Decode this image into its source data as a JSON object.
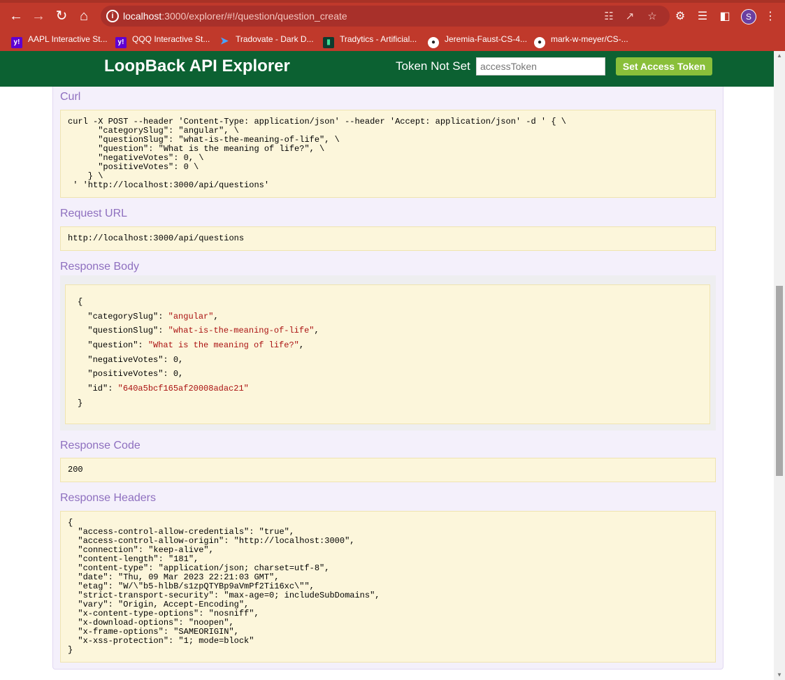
{
  "browser": {
    "url_host": "localhost",
    "url_rest": ":3000/explorer/#!/question/question_create",
    "profile_initial": "S",
    "bookmarks": [
      {
        "label": "AAPL Interactive St...",
        "icon": "yahoo-icon"
      },
      {
        "label": "QQQ Interactive St...",
        "icon": "yahoo-icon"
      },
      {
        "label": "Tradovate - Dark D...",
        "icon": "tradovate-icon"
      },
      {
        "label": "Tradytics - Artificial...",
        "icon": "tradytics-icon"
      },
      {
        "label": "Jeremia-Faust-CS-4...",
        "icon": "github-icon"
      },
      {
        "label": "mark-w-meyer/CS-...",
        "icon": "github-icon"
      }
    ]
  },
  "header": {
    "title": "LoopBack API Explorer",
    "token_status": "Token Not Set",
    "token_placeholder": "accessToken",
    "token_button": "Set Access Token"
  },
  "sections": {
    "curl_label": "Curl",
    "curl_text": "curl -X POST --header 'Content-Type: application/json' --header 'Accept: application/json' -d ' { \\\n      \"categorySlug\": \"angular\", \\\n      \"questionSlug\": \"what-is-the-meaning-of-life\", \\\n      \"question\": \"What is the meaning of life?\", \\\n      \"negativeVotes\": 0, \\\n      \"positiveVotes\": 0 \\\n    } \\\n ' 'http://localhost:3000/api/questions'",
    "request_url_label": "Request URL",
    "request_url": "http://localhost:3000/api/questions",
    "response_body_label": "Response Body",
    "response_body": [
      {
        "key": "categorySlug",
        "value": "angular",
        "kind": "string"
      },
      {
        "key": "questionSlug",
        "value": "what-is-the-meaning-of-life",
        "kind": "string"
      },
      {
        "key": "question",
        "value": "What is the meaning of life?",
        "kind": "string"
      },
      {
        "key": "negativeVotes",
        "value": "0",
        "kind": "number"
      },
      {
        "key": "positiveVotes",
        "value": "0",
        "kind": "number"
      },
      {
        "key": "id",
        "value": "640a5bcf165af20008adac21",
        "kind": "string"
      }
    ],
    "response_code_label": "Response Code",
    "response_code": "200",
    "response_headers_label": "Response Headers",
    "response_headers_text": "{\n  \"access-control-allow-credentials\": \"true\",\n  \"access-control-allow-origin\": \"http://localhost:3000\",\n  \"connection\": \"keep-alive\",\n  \"content-length\": \"181\",\n  \"content-type\": \"application/json; charset=utf-8\",\n  \"date\": \"Thu, 09 Mar 2023 22:21:03 GMT\",\n  \"etag\": \"W/\\\"b5-hlbB/s1zpQTYBp9aVmPf2Ti16xc\\\"\",\n  \"strict-transport-security\": \"max-age=0; includeSubDomains\",\n  \"vary\": \"Origin, Accept-Encoding\",\n  \"x-content-type-options\": \"nosniff\",\n  \"x-download-options\": \"noopen\",\n  \"x-frame-options\": \"SAMEORIGIN\",\n  \"x-xss-protection\": \"1; mode=block\"\n}"
  },
  "colors": {
    "browser_frame": "#c0392b",
    "app_header": "#0c6132",
    "token_button": "#89bf3a",
    "section_label": "#8e6fbf",
    "code_background": "#fcf6db",
    "json_string": "#aa1111"
  }
}
